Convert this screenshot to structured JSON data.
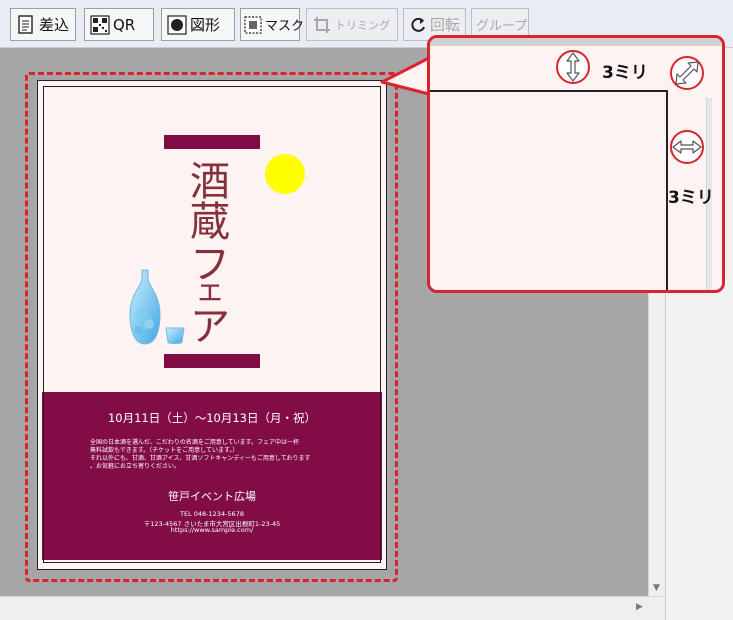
{
  "toolbar": {
    "buttons": [
      {
        "label": "差込",
        "icon": "document-merge-icon",
        "disabled": false
      },
      {
        "label": "QR",
        "icon": "qr-code-icon",
        "disabled": false
      },
      {
        "label": "図形",
        "icon": "shape-icon",
        "disabled": false
      },
      {
        "label": "マスク",
        "icon": "mask-icon",
        "disabled": false
      },
      {
        "label": "トリミング",
        "icon": "crop-icon",
        "disabled": true
      },
      {
        "label": "回転",
        "icon": "rotate-icon",
        "disabled": true
      },
      {
        "label": "グループ",
        "icon": "",
        "disabled": true
      }
    ]
  },
  "flyer": {
    "title_chars": [
      "酒",
      "蔵",
      "フ",
      "ェ",
      "ア"
    ],
    "dates": "10月11日（土）～10月13日（月・祝）",
    "description": [
      "全国の日本酒を選んだ、こだわりの名酒をご用意しています。フェア中は一杯",
      "無料試飲もできます。（チケットをご用意しています。）",
      "それ以外にも、甘酒、甘酒アイス、甘酒ソフトキャンディーもご用意しております",
      "。お気軽にお立ち寄りください。"
    ],
    "venue": "笹戸イベント広場",
    "tel": "TEL 048-1234-5678",
    "address": "〒123-4567  さいたま市大宮区出根町1-23-45",
    "url": "https://www.sample.com/",
    "colors": {
      "band": "#820d46",
      "paper": "#fdf3f2",
      "sun": "#ffff00",
      "title": "#86303b"
    }
  },
  "callout": {
    "vertical_label": "3ミリ",
    "horizontal_label": "3ミリ",
    "accent": "#d9232d"
  }
}
